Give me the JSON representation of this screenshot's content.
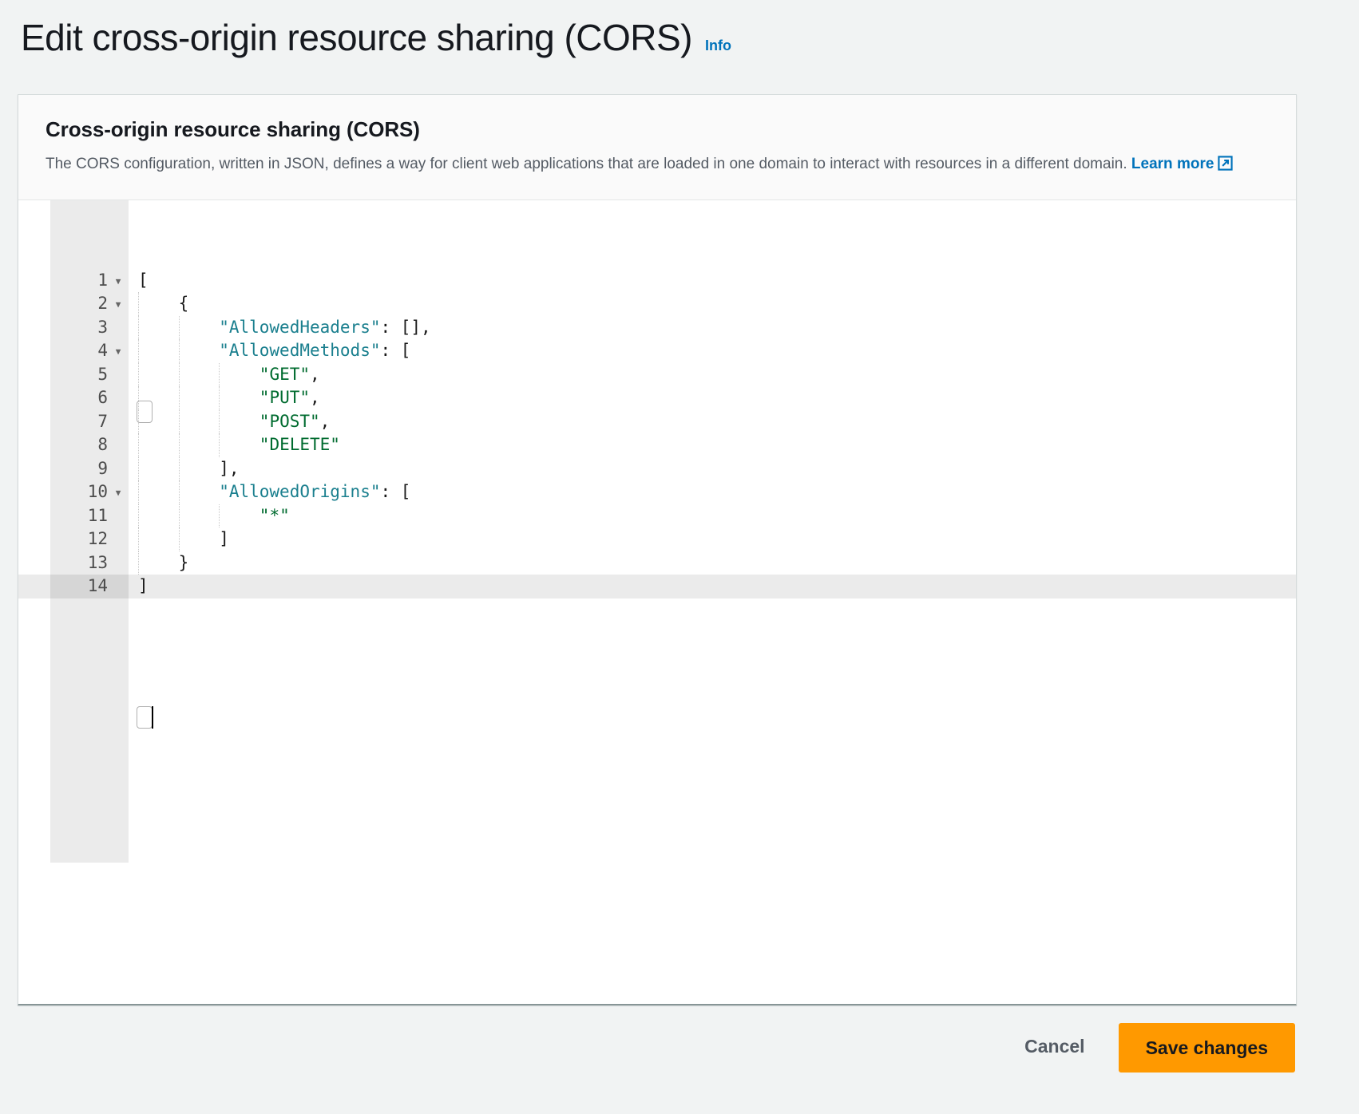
{
  "page": {
    "title": "Edit cross-origin resource sharing (CORS)",
    "info_label": "Info"
  },
  "card": {
    "title": "Cross-origin resource sharing (CORS)",
    "description_part1": "The CORS configuration, written in JSON, defines a way for client web applications that are loaded in one domain to interact with resources in a different domain. ",
    "learn_more_label": "Learn more",
    "external_link_icon": "external-link-icon"
  },
  "editor": {
    "language": "json",
    "active_line": 14,
    "total_lines": 14,
    "cursor": {
      "line": 14,
      "column": 2
    },
    "fold_lines": [
      1,
      2,
      4,
      10
    ],
    "lines": [
      {
        "n": "1",
        "indent": 0,
        "text": "["
      },
      {
        "n": "2",
        "indent": 1,
        "text": "{"
      },
      {
        "n": "3",
        "indent": 2,
        "text": "\"AllowedHeaders\": [],"
      },
      {
        "n": "4",
        "indent": 2,
        "text": "\"AllowedMethods\": ["
      },
      {
        "n": "5",
        "indent": 3,
        "text": "\"GET\","
      },
      {
        "n": "6",
        "indent": 3,
        "text": "\"PUT\","
      },
      {
        "n": "7",
        "indent": 3,
        "text": "\"POST\","
      },
      {
        "n": "8",
        "indent": 3,
        "text": "\"DELETE\""
      },
      {
        "n": "9",
        "indent": 2,
        "text": "],"
      },
      {
        "n": "10",
        "indent": 2,
        "text": "\"AllowedOrigins\": ["
      },
      {
        "n": "11",
        "indent": 3,
        "text": "\"*\""
      },
      {
        "n": "12",
        "indent": 2,
        "text": "]"
      },
      {
        "n": "13",
        "indent": 1,
        "text": "}"
      },
      {
        "n": "14",
        "indent": 0,
        "text": "]"
      }
    ],
    "content": "[\n    {\n        \"AllowedHeaders\": [],\n        \"AllowedMethods\": [\n            \"GET\",\n            \"PUT\",\n            \"POST\",\n            \"DELETE\"\n        ],\n        \"AllowedOrigins\": [\n            \"*\"\n        ]\n    }\n]"
  },
  "footer": {
    "cancel_label": "Cancel",
    "save_label": "Save changes"
  },
  "colors": {
    "accent_orange": "#ff9900",
    "link_blue": "#0073bb",
    "json_key": "#1a7f8e",
    "json_string": "#006b2f",
    "page_bg": "#f1f3f3",
    "gutter_bg": "#ebebeb"
  }
}
